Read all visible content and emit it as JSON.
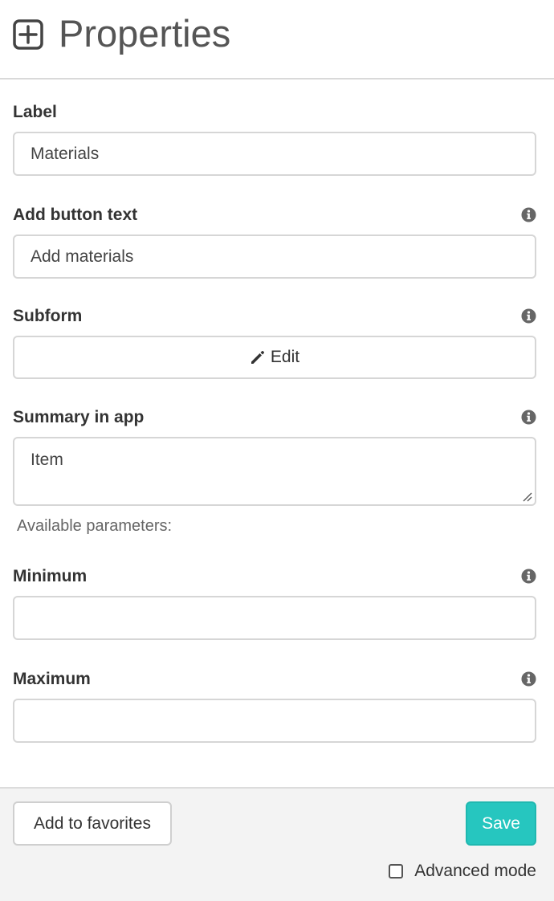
{
  "header": {
    "title": "Properties",
    "icon": "plus-square-icon"
  },
  "fields": {
    "label": {
      "label": "Label",
      "value": "Materials"
    },
    "add_button_text": {
      "label": "Add button text",
      "value": "Add materials",
      "info_icon": "info-circle-icon"
    },
    "subform": {
      "label": "Subform",
      "button_label": "Edit",
      "button_icon": "pencil-icon",
      "info_icon": "info-circle-icon"
    },
    "summary": {
      "label": "Summary in app",
      "value": "Item",
      "help": "Available parameters:",
      "info_icon": "info-circle-icon"
    },
    "minimum": {
      "label": "Minimum",
      "value": "",
      "info_icon": "info-circle-icon"
    },
    "maximum": {
      "label": "Maximum",
      "value": "",
      "info_icon": "info-circle-icon"
    }
  },
  "footer": {
    "favorites_label": "Add to favorites",
    "save_label": "Save",
    "advanced_label": "Advanced mode",
    "advanced_checked": false
  },
  "colors": {
    "accent": "#26c6bf",
    "border": "#d6d6d6",
    "footer_bg": "#f3f3f3"
  }
}
